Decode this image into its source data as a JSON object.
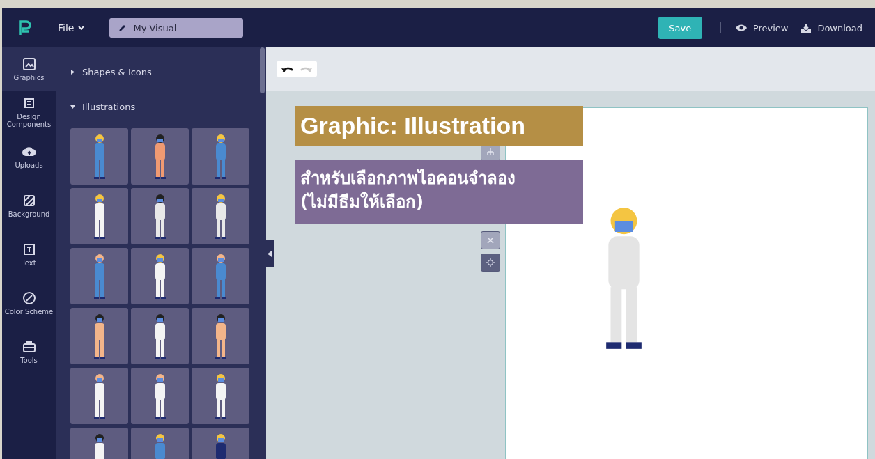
{
  "topbar": {
    "menu": "File",
    "title_value": "My Visual",
    "save": "Save",
    "actions": [
      {
        "kind": "preview",
        "label": "Preview"
      },
      {
        "kind": "download",
        "label": "Download"
      }
    ]
  },
  "nav": [
    {
      "kind": "graphics",
      "label": "Graphics",
      "selected": true
    },
    {
      "kind": "components",
      "label": "Design Components",
      "selected": false
    },
    {
      "kind": "uploads",
      "label": "Uploads",
      "selected": false
    },
    {
      "kind": "background",
      "label": "Background",
      "selected": false
    },
    {
      "kind": "text",
      "label": "Text",
      "selected": false
    },
    {
      "kind": "color",
      "label": "Color Scheme",
      "selected": false
    },
    {
      "kind": "tools",
      "label": "Tools",
      "selected": false
    }
  ],
  "panel": {
    "sections": [
      {
        "label": "Shapes & Icons",
        "expanded": false
      },
      {
        "label": "Illustrations",
        "expanded": true
      }
    ]
  },
  "history": {
    "undo": {
      "disabled": false
    },
    "redo": {
      "disabled": true
    }
  },
  "overlays": {
    "title": "Graphic: Illustration",
    "note_lines": [
      "สำหรับเลือกภาพไอคอนจำลอง",
      "(ไม่มีธีมให้เลือก)"
    ]
  }
}
